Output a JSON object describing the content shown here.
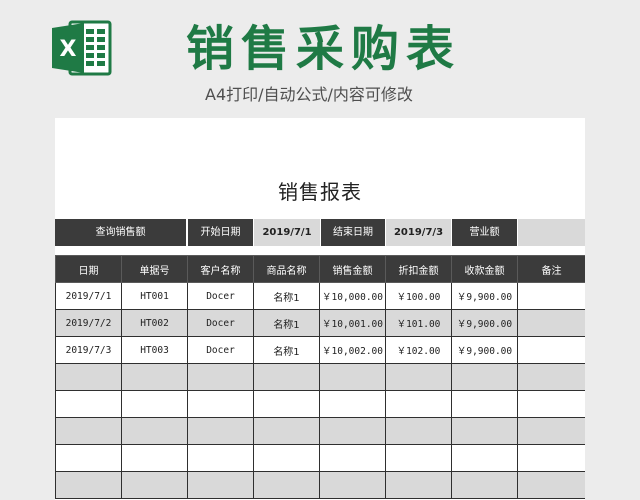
{
  "header": {
    "title": "销售采购表",
    "subtitle": "A4打印/自动公式/内容可修改",
    "logo_letter": "X",
    "brand_color": "#1f7a45"
  },
  "report": {
    "title": "销售报表",
    "query": {
      "label": "查询销售额",
      "start_label": "开始日期",
      "start_value": "2019/7/1",
      "end_label": "结束日期",
      "end_value": "2019/7/3",
      "revenue_label": "营业额",
      "revenue_value": ""
    },
    "columns": [
      "日期",
      "单据号",
      "客户名称",
      "商品名称",
      "销售金额",
      "折扣金额",
      "收款金额",
      "备注"
    ],
    "rows": [
      [
        "2019/7/1",
        "HT001",
        "Docer",
        "名称1",
        "￥10,000.00",
        "￥100.00",
        "￥9,900.00",
        ""
      ],
      [
        "2019/7/2",
        "HT002",
        "Docer",
        "名称1",
        "￥10,001.00",
        "￥101.00",
        "￥9,900.00",
        ""
      ],
      [
        "2019/7/3",
        "HT003",
        "Docer",
        "名称1",
        "￥10,002.00",
        "￥102.00",
        "￥9,900.00",
        ""
      ],
      [
        "",
        "",
        "",
        "",
        "",
        "",
        "",
        ""
      ],
      [
        "",
        "",
        "",
        "",
        "",
        "",
        "",
        ""
      ],
      [
        "",
        "",
        "",
        "",
        "",
        "",
        "",
        ""
      ],
      [
        "",
        "",
        "",
        "",
        "",
        "",
        "",
        ""
      ],
      [
        "",
        "",
        "",
        "",
        "",
        "",
        "",
        ""
      ]
    ]
  }
}
